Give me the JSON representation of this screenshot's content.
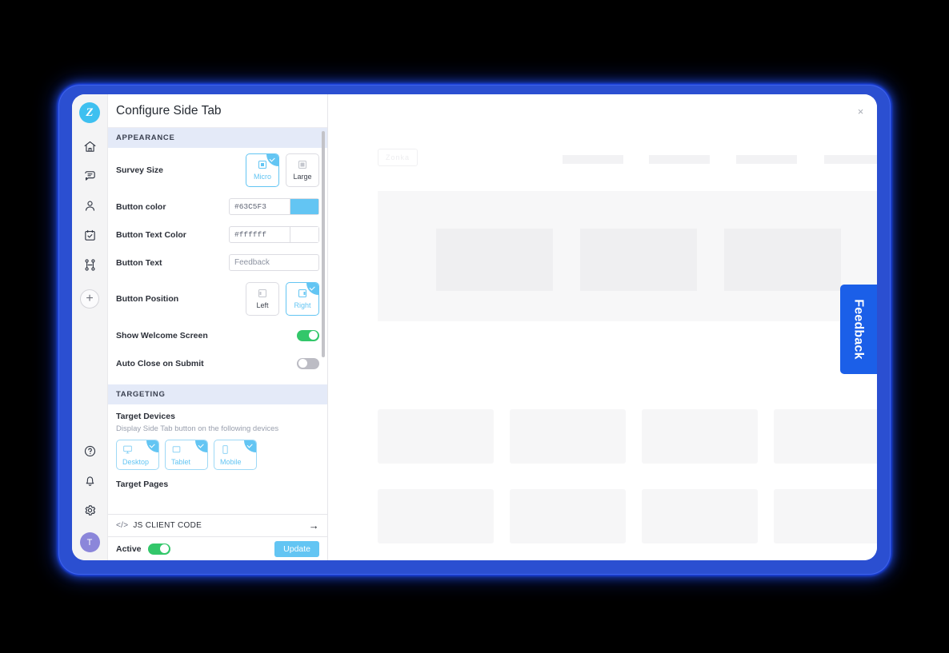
{
  "rail": {
    "logo_text": "Z",
    "logo_name": "zonka-logo",
    "items": [
      {
        "name": "home-icon",
        "label": "Home"
      },
      {
        "name": "chat-icon",
        "label": "Chat"
      },
      {
        "name": "contacts-icon",
        "label": "Contacts"
      },
      {
        "name": "tasks-icon",
        "label": "Tasks"
      },
      {
        "name": "workflow-icon",
        "label": "Workflow"
      }
    ],
    "add_label": "+",
    "bottom": [
      {
        "name": "help-icon",
        "label": "Help"
      },
      {
        "name": "notifications-icon",
        "label": "Notifications"
      },
      {
        "name": "settings-icon",
        "label": "Settings"
      }
    ],
    "avatar_text": "T"
  },
  "panel": {
    "title": "Configure Side Tab",
    "close_label": "×",
    "sections": {
      "appearance": "APPEARANCE",
      "targeting": "TARGETING"
    },
    "survey_size": {
      "label": "Survey Size",
      "options": [
        {
          "label": "Micro",
          "selected": true
        },
        {
          "label": "Large",
          "selected": false
        }
      ]
    },
    "button_color": {
      "label": "Button color",
      "value": "#63C5F3",
      "swatch": "#63C5F3"
    },
    "button_text_color": {
      "label": "Button Text Color",
      "value": "#ffffff",
      "swatch": "#ffffff"
    },
    "button_text": {
      "label": "Button Text",
      "value": "Feedback",
      "placeholder": "Feedback"
    },
    "button_position": {
      "label": "Button Position",
      "options": [
        {
          "label": "Left",
          "selected": false
        },
        {
          "label": "Right",
          "selected": true
        }
      ]
    },
    "show_welcome": {
      "label": "Show Welcome Screen",
      "on": true
    },
    "auto_close": {
      "label": "Auto Close on Submit",
      "on": false
    },
    "target_devices": {
      "title": "Target Devices",
      "subtitle": "Display Side Tab button on the following devices",
      "devices": [
        {
          "label": "Desktop",
          "icon": "desktop-icon",
          "selected": true
        },
        {
          "label": "Tablet",
          "icon": "tablet-icon",
          "selected": true
        },
        {
          "label": "Mobile",
          "icon": "mobile-icon",
          "selected": true
        }
      ]
    },
    "target_pages": {
      "title": "Target Pages"
    },
    "js_client_code": {
      "label": "JS CLIENT CODE",
      "icon": "code-icon",
      "arrow": "→"
    },
    "footer": {
      "active_label": "Active",
      "active_on": true,
      "update_label": "Update"
    }
  },
  "preview": {
    "logo_text": "Zonka",
    "side_tab_label": "Feedback",
    "side_tab_color": "#1B5FE8",
    "highlight_color": "#CDEEFB",
    "arrow_color": "#E62020"
  }
}
